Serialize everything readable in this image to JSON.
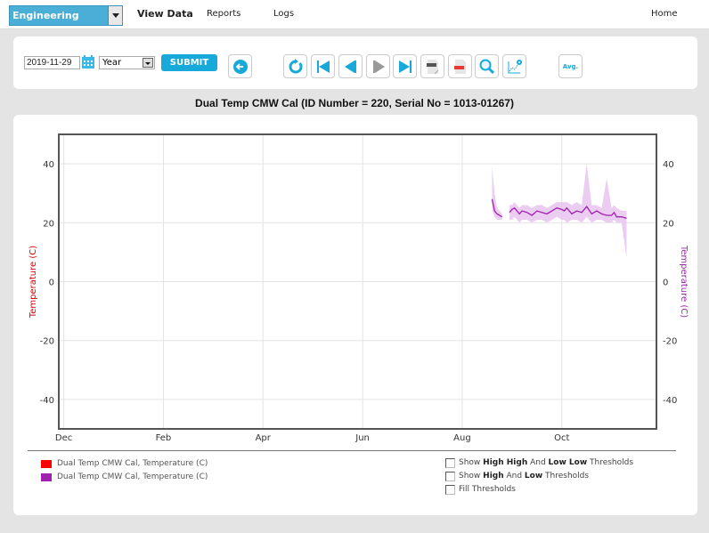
{
  "topbar": {
    "department": "Engineering",
    "nav": [
      "View Data",
      "Reports",
      "Logs"
    ],
    "home": "Home"
  },
  "controls": {
    "date": "2019-11-29",
    "period": "Year",
    "submit": "SUBMIT",
    "avg": "Avg.",
    "icons": [
      "back-icon",
      "refresh-icon",
      "first-icon",
      "previous-icon",
      "next-icon",
      "last-icon",
      "csv-icon",
      "pdf-icon",
      "zoom-icon",
      "chart-settings-icon"
    ]
  },
  "legend": {
    "items": [
      {
        "label": "Dual Temp CMW Cal, Temperature (C)",
        "color": "#ff0000"
      },
      {
        "label": "Dual Temp CMW Cal, Temperature (C)",
        "color": "#a020b0"
      }
    ]
  },
  "thresholds": {
    "hh_prefix": "Show ",
    "hh_b1": "High High",
    "hh_mid": " And ",
    "hh_b2": "Low Low",
    "hh_suffix": " Thresholds",
    "h_prefix": "Show ",
    "h_b1": "High",
    "h_mid": " And ",
    "h_b2": "Low",
    "h_suffix": " Thresholds",
    "fill": "Fill Thresholds"
  },
  "chart_data": {
    "type": "line",
    "title": "Dual Temp CMW Cal (ID Number = 220, Serial No = 1013-01267)",
    "xlabel": "",
    "ylabel_left": "Temperature (C)",
    "ylabel_right": "Temperature (C)",
    "ylim": [
      -50,
      50
    ],
    "yticks": [
      40,
      20,
      0,
      -20,
      -40
    ],
    "xticks": [
      "Dec",
      "Feb",
      "Apr",
      "Jun",
      "Aug",
      "Oct"
    ],
    "x_range_months": [
      -0.1,
      11.9
    ],
    "grid": true,
    "legend": "bottom-left",
    "colors": {
      "left_axis": "#dd0000",
      "right_axis": "#a020b0",
      "line": "#a020b0",
      "band": "#e8c4ee"
    },
    "series": [
      {
        "name": "Dual Temp CMW Cal, Temperature (C)",
        "x_months": [
          8.6,
          8.65,
          8.7,
          8.75,
          8.8
        ],
        "values": [
          28,
          24,
          23,
          22.5,
          22
        ],
        "min": [
          24,
          22,
          21,
          21,
          21
        ],
        "max": [
          39,
          30,
          25,
          24,
          23
        ]
      },
      {
        "name": "Dual Temp CMW Cal, Temperature (C)",
        "x_months": [
          8.95,
          9.0,
          9.05,
          9.1,
          9.15,
          9.2,
          9.3,
          9.4,
          9.5,
          9.6,
          9.7,
          9.8,
          9.9,
          10.0,
          10.05,
          10.1,
          10.2,
          10.3,
          10.4,
          10.5,
          10.6,
          10.7,
          10.8,
          10.9,
          11.0,
          11.05,
          11.1,
          11.2,
          11.3
        ],
        "values": [
          23.5,
          24.5,
          25,
          24,
          23,
          24,
          23.5,
          22.5,
          24,
          23.5,
          23,
          24,
          25,
          24.5,
          24,
          25,
          23,
          24,
          23.5,
          25.5,
          23,
          24,
          23,
          22.5,
          22.5,
          23.5,
          22,
          22,
          21.5
        ],
        "min": [
          21,
          21,
          22,
          21,
          20,
          21,
          21,
          20,
          21,
          21,
          20,
          21,
          22,
          21,
          21,
          20,
          21,
          21,
          20,
          22,
          20,
          21,
          21,
          20,
          20,
          21,
          20,
          20,
          8
        ],
        "max": [
          26,
          26,
          27,
          26,
          25,
          26,
          26,
          25,
          26,
          26,
          25,
          26,
          27,
          27,
          27,
          27,
          26,
          27,
          26,
          40,
          26,
          26,
          25,
          35,
          25,
          26,
          25,
          24,
          24
        ]
      }
    ]
  }
}
